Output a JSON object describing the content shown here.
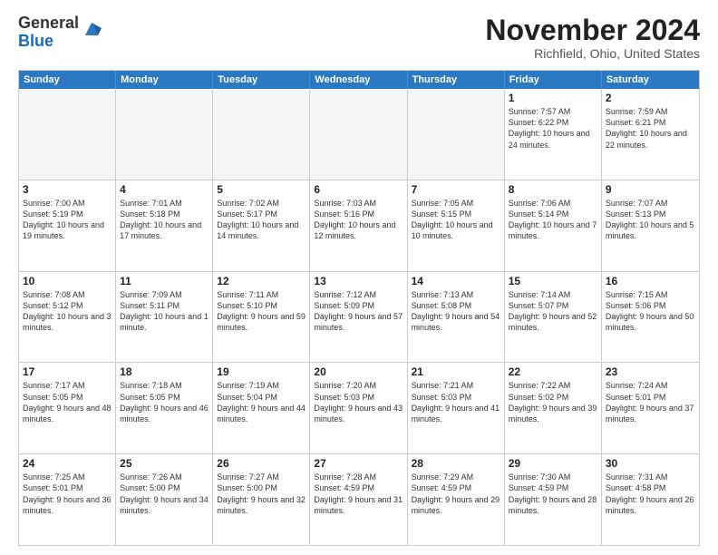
{
  "logo": {
    "general": "General",
    "blue": "Blue"
  },
  "title": "November 2024",
  "location": "Richfield, Ohio, United States",
  "header_days": [
    "Sunday",
    "Monday",
    "Tuesday",
    "Wednesday",
    "Thursday",
    "Friday",
    "Saturday"
  ],
  "rows": [
    [
      {
        "day": "",
        "info": ""
      },
      {
        "day": "",
        "info": ""
      },
      {
        "day": "",
        "info": ""
      },
      {
        "day": "",
        "info": ""
      },
      {
        "day": "",
        "info": ""
      },
      {
        "day": "1",
        "info": "Sunrise: 7:57 AM\nSunset: 6:22 PM\nDaylight: 10 hours and 24 minutes."
      },
      {
        "day": "2",
        "info": "Sunrise: 7:59 AM\nSunset: 6:21 PM\nDaylight: 10 hours and 22 minutes."
      }
    ],
    [
      {
        "day": "3",
        "info": "Sunrise: 7:00 AM\nSunset: 5:19 PM\nDaylight: 10 hours and 19 minutes."
      },
      {
        "day": "4",
        "info": "Sunrise: 7:01 AM\nSunset: 5:18 PM\nDaylight: 10 hours and 17 minutes."
      },
      {
        "day": "5",
        "info": "Sunrise: 7:02 AM\nSunset: 5:17 PM\nDaylight: 10 hours and 14 minutes."
      },
      {
        "day": "6",
        "info": "Sunrise: 7:03 AM\nSunset: 5:16 PM\nDaylight: 10 hours and 12 minutes."
      },
      {
        "day": "7",
        "info": "Sunrise: 7:05 AM\nSunset: 5:15 PM\nDaylight: 10 hours and 10 minutes."
      },
      {
        "day": "8",
        "info": "Sunrise: 7:06 AM\nSunset: 5:14 PM\nDaylight: 10 hours and 7 minutes."
      },
      {
        "day": "9",
        "info": "Sunrise: 7:07 AM\nSunset: 5:13 PM\nDaylight: 10 hours and 5 minutes."
      }
    ],
    [
      {
        "day": "10",
        "info": "Sunrise: 7:08 AM\nSunset: 5:12 PM\nDaylight: 10 hours and 3 minutes."
      },
      {
        "day": "11",
        "info": "Sunrise: 7:09 AM\nSunset: 5:11 PM\nDaylight: 10 hours and 1 minute."
      },
      {
        "day": "12",
        "info": "Sunrise: 7:11 AM\nSunset: 5:10 PM\nDaylight: 9 hours and 59 minutes."
      },
      {
        "day": "13",
        "info": "Sunrise: 7:12 AM\nSunset: 5:09 PM\nDaylight: 9 hours and 57 minutes."
      },
      {
        "day": "14",
        "info": "Sunrise: 7:13 AM\nSunset: 5:08 PM\nDaylight: 9 hours and 54 minutes."
      },
      {
        "day": "15",
        "info": "Sunrise: 7:14 AM\nSunset: 5:07 PM\nDaylight: 9 hours and 52 minutes."
      },
      {
        "day": "16",
        "info": "Sunrise: 7:15 AM\nSunset: 5:06 PM\nDaylight: 9 hours and 50 minutes."
      }
    ],
    [
      {
        "day": "17",
        "info": "Sunrise: 7:17 AM\nSunset: 5:05 PM\nDaylight: 9 hours and 48 minutes."
      },
      {
        "day": "18",
        "info": "Sunrise: 7:18 AM\nSunset: 5:05 PM\nDaylight: 9 hours and 46 minutes."
      },
      {
        "day": "19",
        "info": "Sunrise: 7:19 AM\nSunset: 5:04 PM\nDaylight: 9 hours and 44 minutes."
      },
      {
        "day": "20",
        "info": "Sunrise: 7:20 AM\nSunset: 5:03 PM\nDaylight: 9 hours and 43 minutes."
      },
      {
        "day": "21",
        "info": "Sunrise: 7:21 AM\nSunset: 5:03 PM\nDaylight: 9 hours and 41 minutes."
      },
      {
        "day": "22",
        "info": "Sunrise: 7:22 AM\nSunset: 5:02 PM\nDaylight: 9 hours and 39 minutes."
      },
      {
        "day": "23",
        "info": "Sunrise: 7:24 AM\nSunset: 5:01 PM\nDaylight: 9 hours and 37 minutes."
      }
    ],
    [
      {
        "day": "24",
        "info": "Sunrise: 7:25 AM\nSunset: 5:01 PM\nDaylight: 9 hours and 36 minutes."
      },
      {
        "day": "25",
        "info": "Sunrise: 7:26 AM\nSunset: 5:00 PM\nDaylight: 9 hours and 34 minutes."
      },
      {
        "day": "26",
        "info": "Sunrise: 7:27 AM\nSunset: 5:00 PM\nDaylight: 9 hours and 32 minutes."
      },
      {
        "day": "27",
        "info": "Sunrise: 7:28 AM\nSunset: 4:59 PM\nDaylight: 9 hours and 31 minutes."
      },
      {
        "day": "28",
        "info": "Sunrise: 7:29 AM\nSunset: 4:59 PM\nDaylight: 9 hours and 29 minutes."
      },
      {
        "day": "29",
        "info": "Sunrise: 7:30 AM\nSunset: 4:59 PM\nDaylight: 9 hours and 28 minutes."
      },
      {
        "day": "30",
        "info": "Sunrise: 7:31 AM\nSunset: 4:58 PM\nDaylight: 9 hours and 26 minutes."
      }
    ]
  ]
}
